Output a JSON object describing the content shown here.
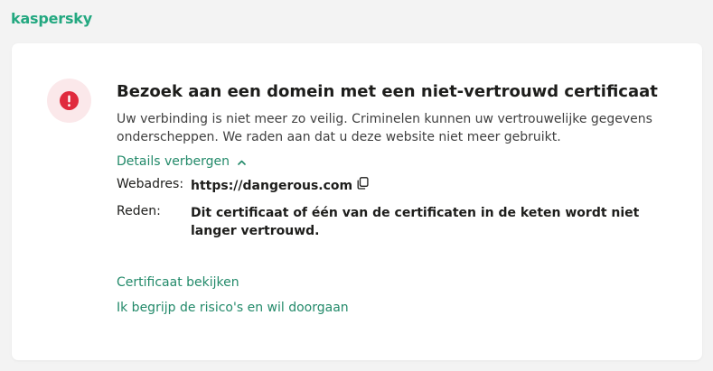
{
  "brand": "kaspersky",
  "colors": {
    "brand": "#23a880",
    "link": "#238a6a",
    "alert": "#e02a3d",
    "alert_bg": "#fbe8ea"
  },
  "alert": {
    "icon": "exclamation-icon",
    "title": "Bezoek aan een domein met een niet-vertrouwd certificaat",
    "description": "Uw verbinding is niet meer zo veilig. Criminelen kunnen uw vertrouwelijke gegevens onderscheppen. We raden aan dat u deze website niet meer gebruikt."
  },
  "details": {
    "toggle_label": "Details verbergen",
    "toggle_icon": "chevron-up-icon",
    "url_label": "Webadres:",
    "url_value": "https://dangerous.com",
    "copy_icon": "copy-icon",
    "reason_label": "Reden:",
    "reason_value": "Dit certificaat of één van de certificaten in de keten wordt niet langer vertrouwd."
  },
  "actions": {
    "view_certificate": "Certificaat bekijken",
    "proceed": "Ik begrijp de risico's en wil doorgaan"
  }
}
